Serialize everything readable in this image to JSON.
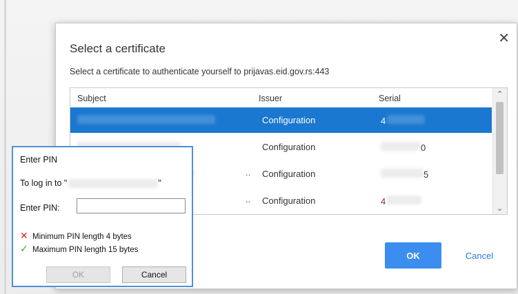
{
  "cert_dialog": {
    "title": "Select a certificate",
    "close_glyph": "✕",
    "subtitle": "Select a certificate to authenticate yourself to prijavas.eid.gov.rs:443",
    "columns": {
      "subject": "Subject",
      "issuer": "Issuer",
      "serial": "Serial"
    },
    "rows": [
      {
        "issuer": "Configuration",
        "serial": "4",
        "selected": true
      },
      {
        "issuer": "Configuration",
        "serial": "0",
        "selected": false
      },
      {
        "issuer": "Configuration",
        "serial": "5",
        "selected": false
      },
      {
        "issuer": "Configuration",
        "serial": "4",
        "selected": false
      }
    ],
    "row_dots": "..",
    "scroll_up": "⌃",
    "scroll_down": "⌄",
    "ok_label": "OK",
    "cancel_label": "Cancel",
    "colors": {
      "selection": "#1a78d0",
      "ok_button": "#3b8ef0",
      "cancel_text": "#2e7bd6"
    }
  },
  "pin_dialog": {
    "title": "Enter PIN",
    "login_prefix": "To log in to \"",
    "login_suffix": "\"",
    "pin_label": "Enter PIN:",
    "pin_value": "",
    "rules": [
      {
        "icon": "cross-icon",
        "glyph": "✕",
        "text": "Minimum PIN length 4 bytes"
      },
      {
        "icon": "check-icon",
        "glyph": "✓",
        "text": "Maximum PIN length 15 bytes"
      }
    ],
    "ok_label": "OK",
    "cancel_label": "Cancel",
    "colors": {
      "border": "#4a90d9",
      "cross": "#e02020",
      "check": "#2eaa2e"
    }
  }
}
